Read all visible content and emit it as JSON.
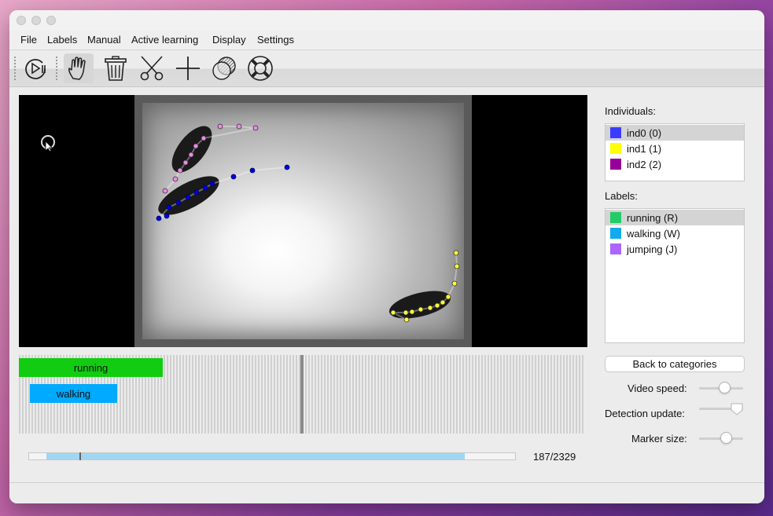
{
  "menu": [
    "File",
    "Labels",
    "Manual",
    "Active learning",
    "Display",
    "Settings"
  ],
  "toolbar": {
    "icons": [
      "play-pause-icon",
      "hand-icon",
      "trash-icon",
      "scissors-icon",
      "plus-icon",
      "shade-circle-icon",
      "lifebuoy-icon"
    ]
  },
  "video": {
    "cursor": "busy-cursor-icon",
    "colors": {
      "ind0": "#0000dd",
      "ind1": "#ffff33",
      "ind2": "#ee88ee"
    }
  },
  "timeline": {
    "segments": [
      {
        "label": "running",
        "color": "#11cc11"
      },
      {
        "label": "walking",
        "color": "#00aaff"
      }
    ]
  },
  "progress": {
    "counter": "187/2329",
    "current_frame": 187,
    "total_frames": 2329
  },
  "individuals": {
    "title": "Individuals:",
    "items": [
      {
        "label": "ind0 (0)",
        "color": "#3b3bff"
      },
      {
        "label": "ind1 (1)",
        "color": "#ffff00"
      },
      {
        "label": "ind2 (2)",
        "color": "#990099"
      }
    ]
  },
  "labels": {
    "title": "Labels:",
    "items": [
      {
        "label": "running (R)",
        "color": "#22cc66"
      },
      {
        "label": "walking (W)",
        "color": "#11aaee"
      },
      {
        "label": "jumping (J)",
        "color": "#aa66ff"
      }
    ]
  },
  "back_button": "Back to categories",
  "settings": {
    "video_speed": "Video speed:",
    "detection_update": "Detection update:",
    "marker_size": "Marker size:"
  }
}
